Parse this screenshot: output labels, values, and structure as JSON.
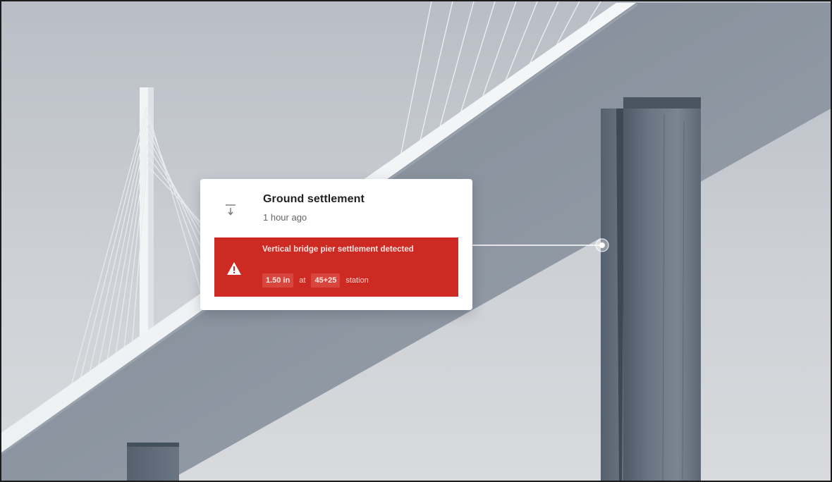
{
  "alert": {
    "title": "Ground settlement",
    "time": "1 hour ago",
    "icon": "settlement-arrow-icon",
    "warning": {
      "icon": "warning-triangle-icon",
      "message": "Vertical bridge pier settlement detected",
      "value": "1.50 in",
      "connector": "at",
      "station": "45+25",
      "suffix": "station"
    }
  },
  "colors": {
    "alert_red": "#cc2a22",
    "card_background": "#ffffff",
    "sky": "#c9ccd1"
  }
}
